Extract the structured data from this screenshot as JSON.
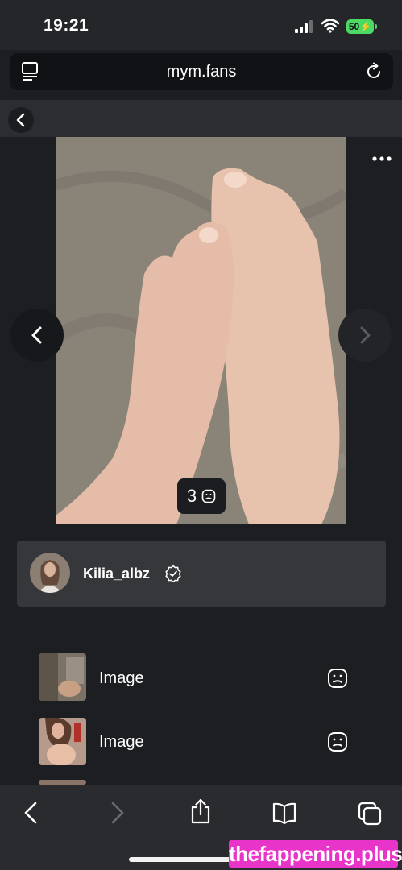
{
  "status_bar": {
    "time": "19:21",
    "battery": "50"
  },
  "browser": {
    "url": "mym.fans"
  },
  "viewer": {
    "counter": "3"
  },
  "author": {
    "name": "Kilia_albz"
  },
  "media_list": [
    {
      "label": "Image"
    },
    {
      "label": "Image"
    }
  ],
  "watermark": "thefappening.plus",
  "colors": {
    "accent_green": "#4cd964",
    "watermark_pink": "#e834c8",
    "background": "#1d1e22"
  }
}
